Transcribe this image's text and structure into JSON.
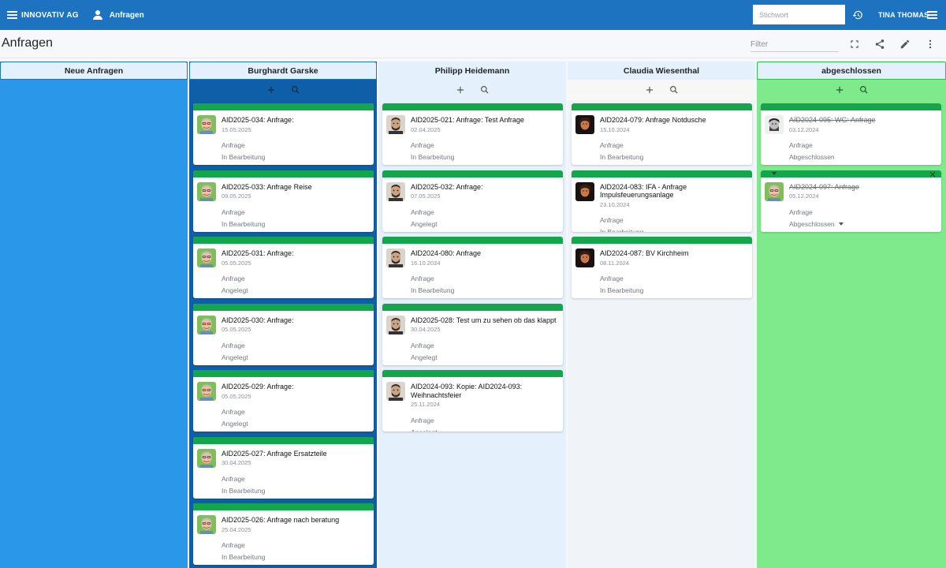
{
  "appbar": {
    "company": "INNOVATIV AG",
    "module": "Anfragen",
    "search_placeholder": "Stichwort",
    "user": "TINA THOMAS"
  },
  "page": {
    "title": "Anfragen",
    "filter_placeholder": "Filter"
  },
  "colors": {
    "appbar": "#1d73c0",
    "card_bar": "#14a64a",
    "col_neu": "#2b97e8",
    "col_garske": "#0f5fa8",
    "col_heidemann": "#e4f0fb",
    "col_wiesenthal": "#f0f4f8",
    "col_abgeschlossen": "#7fea8c"
  },
  "columns": [
    {
      "name": "Neue Anfragen",
      "cards": []
    },
    {
      "name": "Burghardt Garske",
      "avatar": "face-garske",
      "cards": [
        {
          "title": "AID2025-034: Anfrage:",
          "date": "15.05.2025",
          "type": "Anfrage",
          "status": "In Bearbeitung"
        },
        {
          "title": "AID2025-033: Anfrage Reise",
          "date": "09.05.2025",
          "type": "Anfrage",
          "status": "In Bearbeitung"
        },
        {
          "title": "AID2025-031: Anfrage:",
          "date": "05.05.2025",
          "type": "Anfrage",
          "status": "Angelegt"
        },
        {
          "title": "AID2025-030: Anfrage:",
          "date": "05.05.2025",
          "type": "Anfrage",
          "status": "Angelegt"
        },
        {
          "title": "AID2025-029: Anfrage:",
          "date": "05.05.2025",
          "type": "Anfrage",
          "status": "Angelegt"
        },
        {
          "title": "AID2025-027: Anfrage Ersatzteile",
          "date": "30.04.2025",
          "type": "Anfrage",
          "status": "In Bearbeitung"
        },
        {
          "title": "AID2025-026: Anfrage nach beratung",
          "date": "25.04.2025",
          "type": "Anfrage",
          "status": "In Bearbeitung"
        }
      ]
    },
    {
      "name": "Philipp Heidemann",
      "avatar": "face-heidemann",
      "cards": [
        {
          "title": "AID2025-021: Anfrage: Test Anfrage",
          "date": "02.04.2025",
          "type": "Anfrage",
          "status": "In Bearbeitung"
        },
        {
          "title": "AID2025-032: Anfrage:",
          "date": "07.05.2025",
          "type": "Anfrage",
          "status": "Angelegt"
        },
        {
          "title": "AID2024-080: Anfrage",
          "date": "16.10.2024",
          "type": "Anfrage",
          "status": "In Bearbeitung"
        },
        {
          "title": "AID2025-028: Test um zu sehen ob das klappt",
          "date": "30.04.2025",
          "type": "Anfrage",
          "status": "Angelegt"
        },
        {
          "title": "AID2024-093: Kopie: AID2024-093: Weihnachtsfeier",
          "date": "25.11.2024",
          "type": "Anfrage",
          "status": "Angelegt"
        }
      ]
    },
    {
      "name": "Claudia Wiesenthal",
      "avatar": "face-wiesenthal",
      "cards": [
        {
          "title": "AID2024-079: Anfrage Notdusche",
          "date": "15.10.2024",
          "type": "Anfrage",
          "status": "In Bearbeitung"
        },
        {
          "title": "AID2024-083: IFA - Anfrage Impulsfeuerungsanlage",
          "date": "23.10.2024",
          "type": "Anfrage",
          "status": "In Bearbeitung"
        },
        {
          "title": "AID2024-087: BV Kirchheim",
          "date": "08.11.2024",
          "type": "Anfrage",
          "status": "In Bearbeitung"
        }
      ]
    },
    {
      "name": "abgeschlossen",
      "cards": [
        {
          "title": "AID2024-095: WG: Anfrage",
          "date": "03.12.2024",
          "type": "Anfrage",
          "status": "Abgeschlossen",
          "avatar": "face-bw"
        },
        {
          "title": "AID2024-097: Anfrage",
          "date": "05.12.2024",
          "type": "Anfrage",
          "status": "Abgeschlossen",
          "avatar": "face-garske",
          "expanded": true
        }
      ]
    }
  ]
}
